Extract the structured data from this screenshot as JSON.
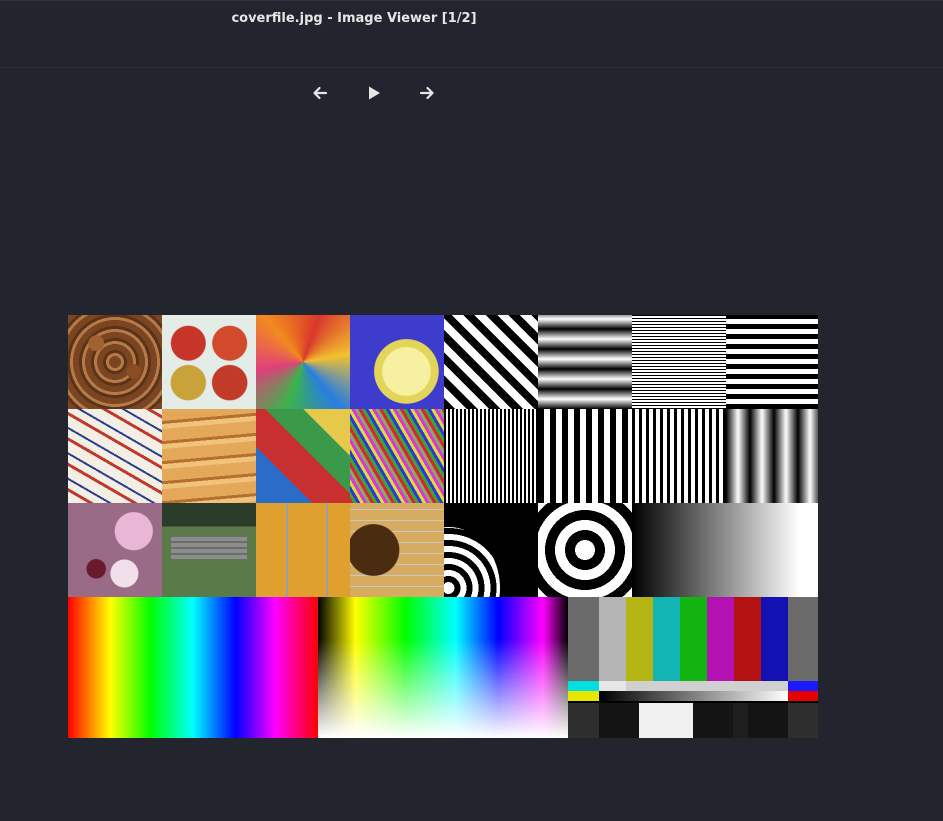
{
  "window": {
    "title": "coverfile.jpg - Image Viewer [1/2]"
  },
  "toolbar": {
    "prev_icon": "arrow-left-icon",
    "play_icon": "play-icon",
    "next_icon": "arrow-right-icon"
  },
  "colors": {
    "background": "#22252d",
    "title_text": "#e6e6e6",
    "icon": "#e6e6e6"
  },
  "image": {
    "tiles_row1": [
      "almonds",
      "apples",
      "balloons",
      "bananas",
      "diagonal-stripes",
      "horizontal-gradient-stripes",
      "horizontal-fine-stripes",
      "horizontal-bars"
    ],
    "tiles_row2": [
      "playing-cards",
      "carrots",
      "plastic-shapes",
      "paper-clips",
      "vertical-fine-stripes",
      "vertical-bars",
      "vertical-medium-stripes",
      "vertical-gradient-stripes"
    ],
    "tiles_row3": [
      "flowers",
      "picnic-bench",
      "guitar-strings",
      "guitar-soundhole",
      "quarter-circles",
      "concentric-target",
      "grey-ramp"
    ],
    "tiles_row4": [
      "rainbow-gradient",
      "hue-ramp",
      "colour-bars"
    ],
    "colour_bars_top": [
      "#6b6b6b",
      "#b4b4b4",
      "#b4b412",
      "#12b4b4",
      "#12b412",
      "#b412b4",
      "#b41212",
      "#1212b4",
      "#6b6b6b"
    ],
    "colour_bars_low": [
      "#2e2e2e",
      "#141414",
      "#f0f0f0",
      "#141414",
      "#1e1e1e",
      "#141414",
      "#2e2e2e"
    ]
  }
}
